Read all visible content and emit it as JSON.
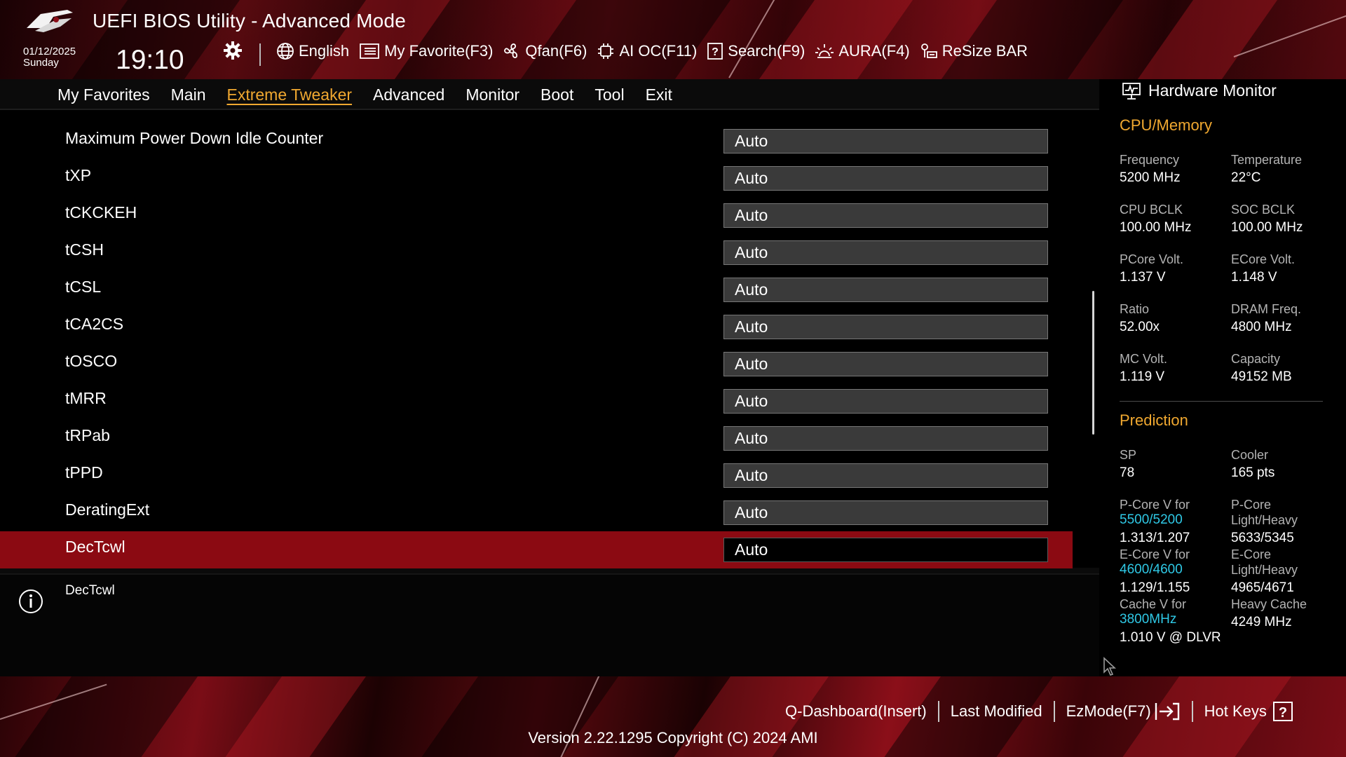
{
  "app": {
    "title": "UEFI BIOS Utility - Advanced Mode",
    "date": "01/12/2025",
    "day": "Sunday",
    "time": "19:10",
    "logo_icon": "rog-eye-logo",
    "accent_color": "#f0a830",
    "highlight_color": "#8b0a12",
    "link_color": "#2fc9e6"
  },
  "toolbar": {
    "language": "English",
    "my_favorite": "My Favorite(F3)",
    "qfan": "Qfan(F6)",
    "ai_oc": "AI OC(F11)",
    "search": "Search(F9)",
    "aura": "AURA(F4)",
    "resize_bar": "ReSize BAR"
  },
  "tabs": [
    "My Favorites",
    "Main",
    "Extreme Tweaker",
    "Advanced",
    "Monitor",
    "Boot",
    "Tool",
    "Exit"
  ],
  "active_tab": "Extreme Tweaker",
  "settings": [
    {
      "label": "Maximum Power Down Idle Counter",
      "value": "Auto"
    },
    {
      "label": "tXP",
      "value": "Auto"
    },
    {
      "label": "tCKCKEH",
      "value": "Auto"
    },
    {
      "label": "tCSH",
      "value": "Auto"
    },
    {
      "label": "tCSL",
      "value": "Auto"
    },
    {
      "label": "tCA2CS",
      "value": "Auto"
    },
    {
      "label": "tOSCO",
      "value": "Auto"
    },
    {
      "label": "tMRR",
      "value": "Auto"
    },
    {
      "label": "tRPab",
      "value": "Auto"
    },
    {
      "label": "tPPD",
      "value": "Auto"
    },
    {
      "label": "DeratingExt",
      "value": "Auto"
    },
    {
      "label": "DecTcwl",
      "value": "Auto"
    }
  ],
  "selected_setting": "DecTcwl",
  "help": {
    "text": "DecTcwl"
  },
  "hw_monitor": {
    "title": "Hardware Monitor",
    "cpu_memory_title": "CPU/Memory",
    "cpu_memory": [
      {
        "label": "Frequency",
        "value": "5200 MHz"
      },
      {
        "label": "Temperature",
        "value": "22°C"
      },
      {
        "label": "CPU BCLK",
        "value": "100.00 MHz"
      },
      {
        "label": "SOC BCLK",
        "value": "100.00 MHz"
      },
      {
        "label": "PCore Volt.",
        "value": "1.137 V"
      },
      {
        "label": "ECore Volt.",
        "value": "1.148 V"
      },
      {
        "label": "Ratio",
        "value": "52.00x"
      },
      {
        "label": "DRAM Freq.",
        "value": "4800 MHz"
      },
      {
        "label": "MC Volt.",
        "value": "1.119 V"
      },
      {
        "label": "Capacity",
        "value": "49152 MB"
      }
    ],
    "prediction_title": "Prediction",
    "prediction": {
      "sp_label": "SP",
      "sp_value": "78",
      "cooler_label": "Cooler",
      "cooler_value": "165 pts",
      "pcore_v_label": "P-Core V for",
      "pcore_v_freq": "5500/5200",
      "pcore_v_value": "1.313/1.207",
      "pcore_lh_label_1": "P-Core",
      "pcore_lh_label_2": "Light/Heavy",
      "pcore_lh_value": "5633/5345",
      "ecore_v_label": "E-Core V for",
      "ecore_v_freq": "4600/4600",
      "ecore_v_value": "1.129/1.155",
      "ecore_lh_label_1": "E-Core",
      "ecore_lh_label_2": "Light/Heavy",
      "ecore_lh_value": "4965/4671",
      "cache_v_label": "Cache V for",
      "cache_v_freq": "3800MHz",
      "cache_v_value": "1.010 V @ DLVR",
      "heavy_cache_label": "Heavy Cache",
      "heavy_cache_value": "4249 MHz"
    }
  },
  "footer": {
    "q_dashboard": "Q-Dashboard(Insert)",
    "last_modified": "Last Modified",
    "ezmode": "EzMode(F7)",
    "hot_keys": "Hot Keys",
    "version": "Version 2.22.1295 Copyright (C) 2024 AMI"
  }
}
